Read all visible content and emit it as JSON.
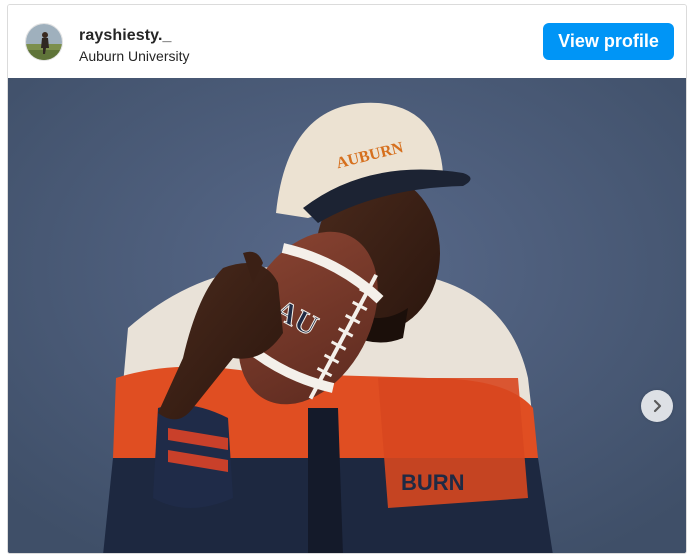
{
  "post": {
    "username": "rayshiesty._",
    "location": "Auburn University",
    "view_profile_label": "View profile",
    "photo_description": "Athlete in Auburn cap holding a football",
    "cap_text": "AUBURN",
    "ball_logo": "AU",
    "jacket_text": "BURN"
  },
  "icons": {
    "next": "chevron-right-icon"
  },
  "colors": {
    "accent": "#0095f6",
    "background": "#4b5c76"
  }
}
